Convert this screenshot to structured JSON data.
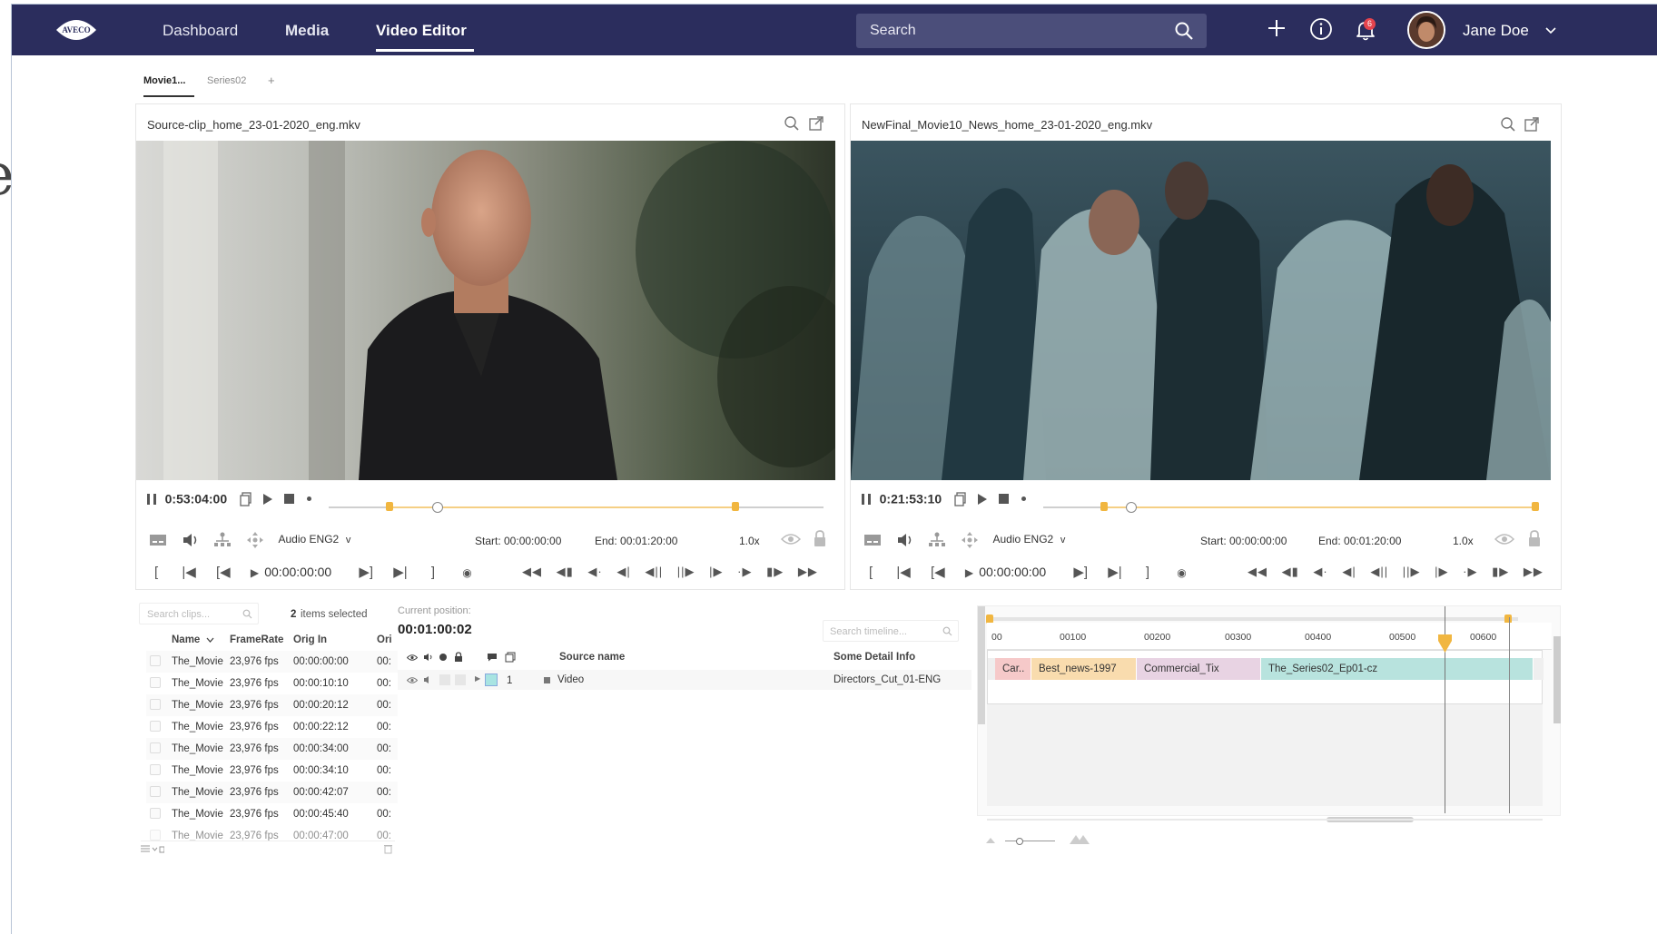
{
  "nav": {
    "logo_text": "AVECO",
    "links": [
      "Dashboard",
      "Media",
      "Video Editor"
    ],
    "active_link": "Video Editor",
    "search_placeholder": "Search",
    "notification_count": "6",
    "user_name": "Jane Doe",
    "icons": [
      "plus-icon",
      "info-icon",
      "bell-icon",
      "chevron-down-icon",
      "search-icon"
    ]
  },
  "edge_text": "e",
  "tabs": [
    {
      "label": "Movie1...",
      "active": true
    },
    {
      "label": "Series02",
      "active": false
    },
    {
      "label": "+",
      "active": false
    }
  ],
  "source_player": {
    "title": "Source-clip_home_23-01-2020_eng.mkv",
    "timecode": "0:53:04:00",
    "audio": "Audio ENG2",
    "start": "Start: 00:00:00:00",
    "end": "End: 00:01:20:00",
    "speed": "1.0x",
    "position": "00:00:00:00"
  },
  "program_player": {
    "title": "NewFinal_Movie10_News_home_23-01-2020_eng.mkv",
    "timecode": "0:21:53:10",
    "audio": "Audio ENG2",
    "start": "Start: 00:00:00:00",
    "end": "End: 00:01:20:00",
    "speed": "1.0x",
    "position": "00:00:00:00"
  },
  "clips": {
    "search_placeholder": "Search clips...",
    "selected_count": "2",
    "selected_label": "items selected",
    "headers": [
      "Name",
      "FrameRate",
      "Orig In",
      "Ori"
    ],
    "rows": [
      [
        "The_Movie",
        "23,976 fps",
        "00:00:00:00",
        "00:"
      ],
      [
        "The_Movie",
        "23,976 fps",
        "00:00:10:10",
        "00:"
      ],
      [
        "The_Movie",
        "23,976 fps",
        "00:00:20:12",
        "00:"
      ],
      [
        "The_Movie",
        "23,976 fps",
        "00:00:22:12",
        "00:"
      ],
      [
        "The_Movie",
        "23,976 fps",
        "00:00:34:00",
        "00:"
      ],
      [
        "The_Movie",
        "23,976 fps",
        "00:00:34:10",
        "00:"
      ],
      [
        "The_Movie",
        "23,976 fps",
        "00:00:42:07",
        "00:"
      ],
      [
        "The_Movie",
        "23,976 fps",
        "00:00:45:40",
        "00:"
      ],
      [
        "The_Movie",
        "23,976 fps",
        "00:00:47:00",
        "00:"
      ]
    ]
  },
  "tracks": {
    "current_position_label": "Current position:",
    "current_position": "00:01:00:02",
    "search_placeholder": "Search timeline...",
    "col_source": "Source name",
    "col_detail": "Some Detail Info",
    "track_number": "1",
    "track_name": "Video",
    "track_detail": "Directors_Cut_01-ENG"
  },
  "timeline": {
    "ruler": [
      "00",
      "00100",
      "00200",
      "00300",
      "00400",
      "00500",
      "00600"
    ],
    "segments": [
      {
        "label": "Car..",
        "color": "#f6c9c9"
      },
      {
        "label": "Best_news-1997",
        "color": "#f9dcae"
      },
      {
        "label": "Commercial_Tix",
        "color": "#e8d3e3"
      },
      {
        "label": "The_Series02_Ep01-cz",
        "color": "#b8e3de"
      }
    ]
  },
  "colors": {
    "nav_bg": "#2b2d5d",
    "accent_marker": "#f1b640"
  }
}
